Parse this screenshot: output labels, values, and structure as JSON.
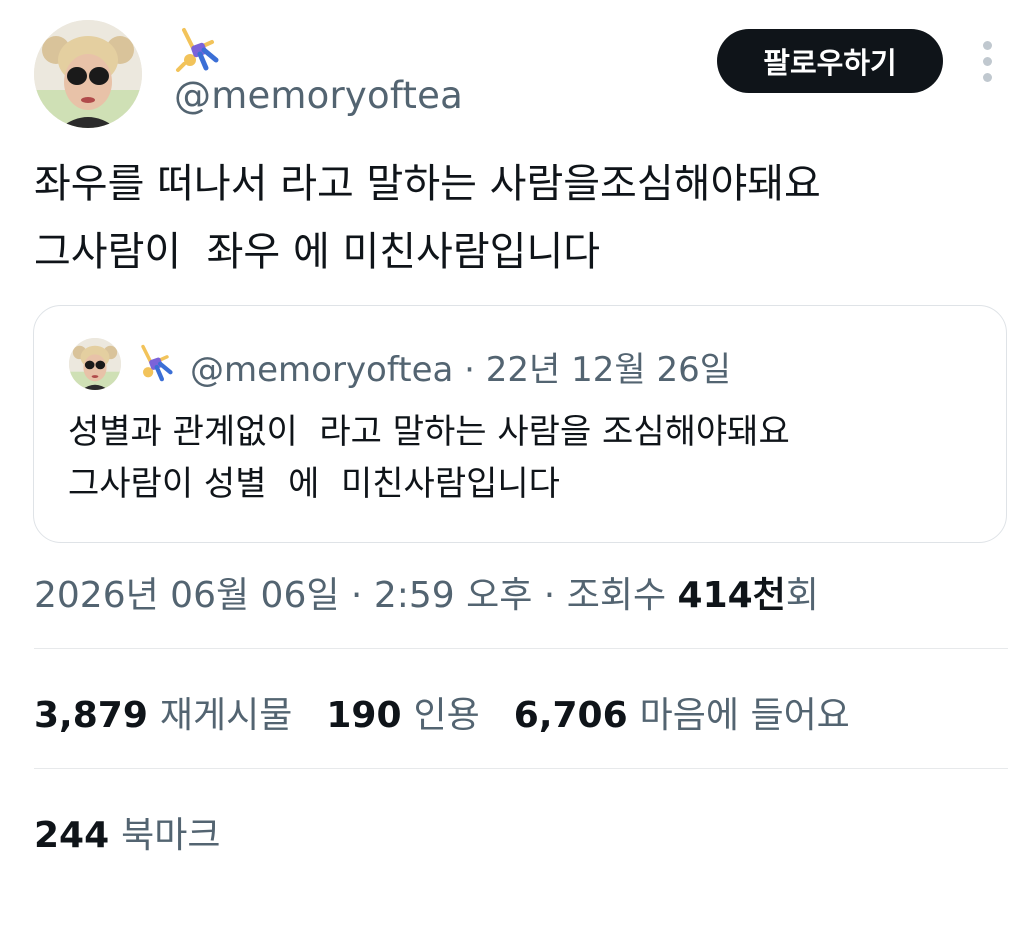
{
  "author": {
    "handle": "@memoryoftea",
    "avatar_icon": "profile-photo-avatar",
    "badge_icon": "cartwheel-person-emoji"
  },
  "header": {
    "follow_label": "팔로우하기",
    "more_icon": "vertical-ellipsis-icon"
  },
  "tweet": {
    "text": "좌우를 떠나서 라고 말하는 사람을조심해야돼요\n그사람이  좌우 에 미친사람입니다"
  },
  "quote": {
    "handle": "@memoryoftea",
    "separator": " · ",
    "date": "22년 12월 26일",
    "text": "성별과 관계없이  라고 말하는 사람을 조심해야돼요\n그사람이 성별  에  미친사람입니다"
  },
  "meta": {
    "date": "2026년 06월 06일",
    "sep1": " · ",
    "time": "2:59 오후",
    "sep2": " · ",
    "views_prefix": "조회수 ",
    "views_count": "414천",
    "views_suffix": "회"
  },
  "stats": {
    "retweets": {
      "count": "3,879",
      "label": "재게시물"
    },
    "quotes": {
      "count": "190",
      "label": "인용"
    },
    "likes": {
      "count": "6,706",
      "label": "마음에 들어요"
    }
  },
  "bookmarks": {
    "count": "244",
    "label": "북마크"
  },
  "colors": {
    "text_primary": "#0f1419",
    "text_secondary": "#536471",
    "button_bg": "#0f1419",
    "border": "#dfe3e7"
  }
}
